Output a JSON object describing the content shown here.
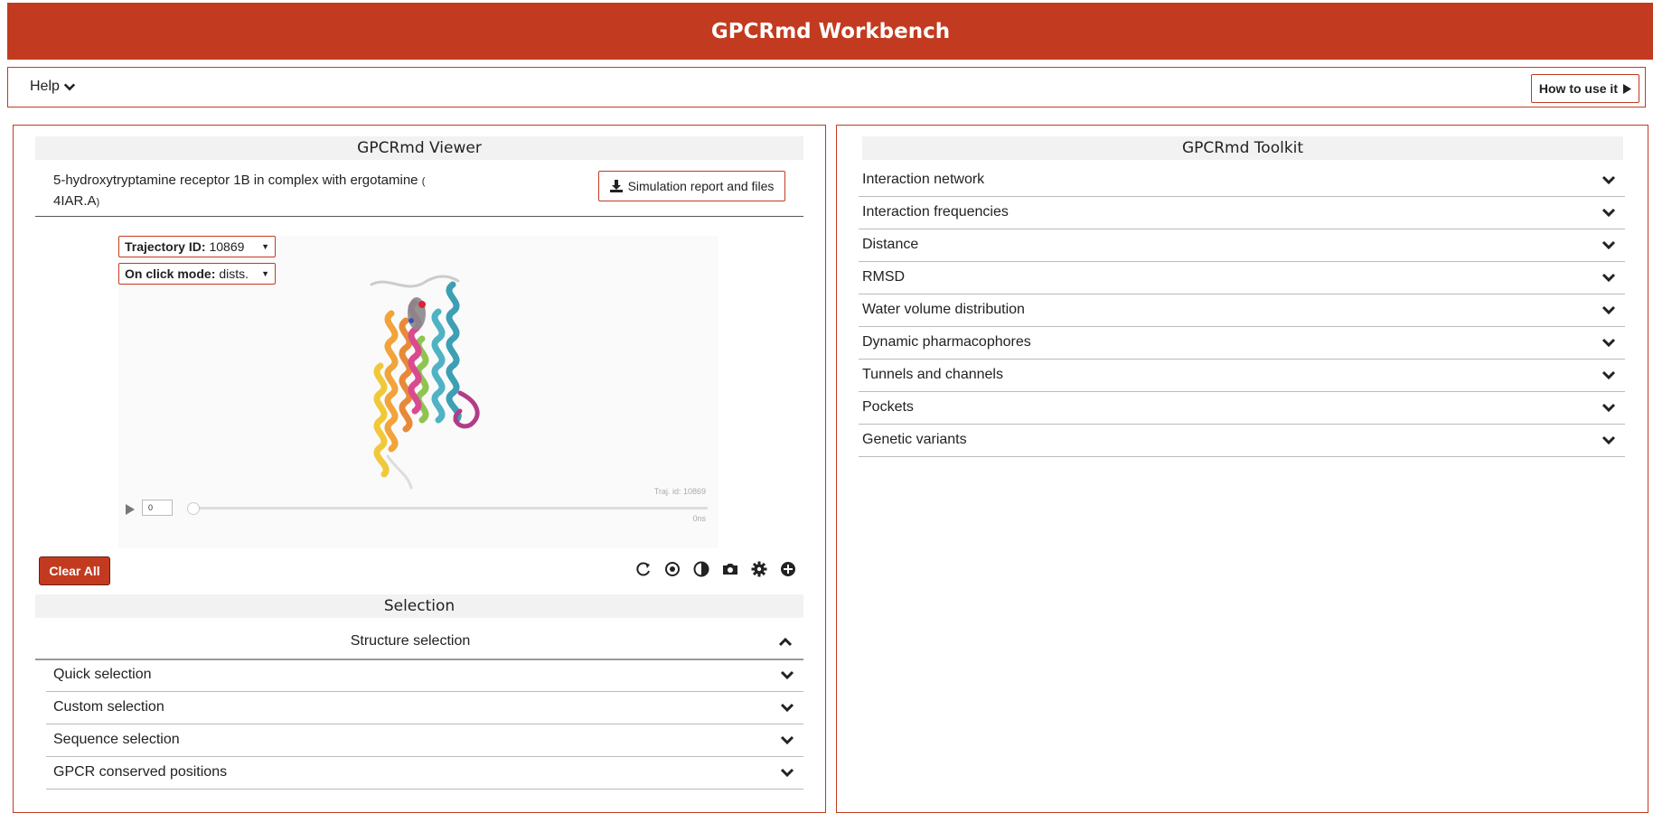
{
  "header": {
    "title": "GPCRmd Workbench"
  },
  "helpbar": {
    "help_label": "Help",
    "howto_label": "How to use it"
  },
  "viewer_panel": {
    "title": "GPCRmd Viewer",
    "sim_title": "5-hydroxytryptamine receptor 1B in complex with ergotamine",
    "pdb_open": "(",
    "pdb_id": "4IAR.A",
    "pdb_close": ")",
    "report_button": "Simulation report and files",
    "trajectory": {
      "label": "Trajectory ID:",
      "value": "10869"
    },
    "click_mode": {
      "label": "On click mode:",
      "value": "dists."
    },
    "player": {
      "frame": "0",
      "traj_caption": "Traj. id: 10869",
      "time_caption": "0ns"
    },
    "clear_button": "Clear All",
    "tool_icons": [
      "reload-icon",
      "center-icon",
      "contrast-icon",
      "camera-icon",
      "gear-icon",
      "plus-circle-icon"
    ]
  },
  "selection": {
    "title": "Selection",
    "structure_selection": "Structure selection",
    "items": [
      {
        "label": "Quick selection"
      },
      {
        "label": "Custom selection"
      },
      {
        "label": "Sequence selection"
      },
      {
        "label": "GPCR conserved positions"
      }
    ]
  },
  "toolkit": {
    "title": "GPCRmd Toolkit",
    "items": [
      {
        "label": "Interaction network"
      },
      {
        "label": "Interaction frequencies"
      },
      {
        "label": "Distance"
      },
      {
        "label": "RMSD"
      },
      {
        "label": "Water volume distribution"
      },
      {
        "label": "Dynamic pharmacophores"
      },
      {
        "label": "Tunnels and channels"
      },
      {
        "label": "Pockets"
      },
      {
        "label": "Genetic variants"
      }
    ]
  },
  "colors": {
    "brand": "#c23b20",
    "panel_header_bg": "#f2f2f2"
  }
}
